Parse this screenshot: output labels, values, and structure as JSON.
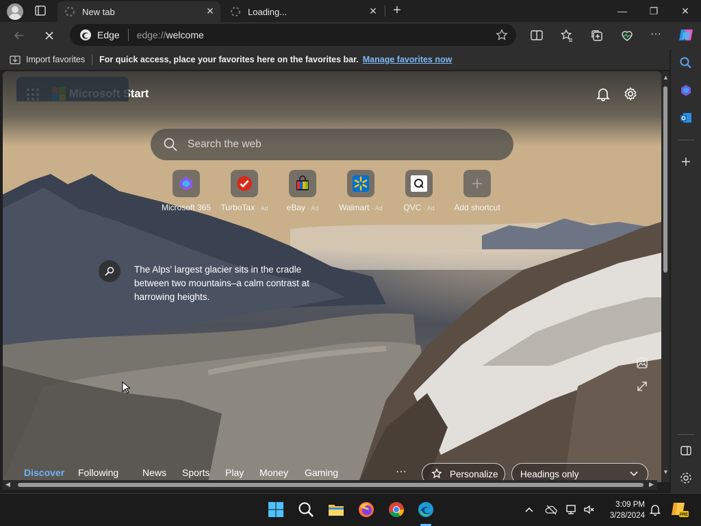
{
  "window": {
    "tabs": [
      {
        "title": "New tab",
        "active": true
      },
      {
        "title": "Loading...",
        "active": false
      }
    ],
    "controls": {
      "minimize": "—",
      "maximize": "❐",
      "close": "✕"
    }
  },
  "toolbar": {
    "site_label": "Edge",
    "url_scheme": "edge://",
    "url_host": "welcome"
  },
  "favorites_bar": {
    "import_label": "Import favorites",
    "message": "For quick access, place your favorites here on the favorites bar.",
    "manage_link": "Manage favorites now"
  },
  "page": {
    "brand": "Microsoft Start",
    "search_placeholder": "Search the web",
    "shortcuts": [
      {
        "label": "Microsoft 365",
        "ad": ""
      },
      {
        "label": "TurboTax",
        "ad": "· Ad"
      },
      {
        "label": "eBay",
        "ad": "· Ad"
      },
      {
        "label": "Walmart",
        "ad": "· Ad"
      },
      {
        "label": "QVC",
        "ad": "· Ad"
      },
      {
        "label": "Add shortcut",
        "ad": ""
      }
    ],
    "image_caption": "The Alps' largest glacier sits in the cradle between two mountains–a calm contrast at harrowing heights.",
    "feed_tabs": [
      "Discover",
      "Following",
      "News",
      "Sports",
      "Play",
      "Money",
      "Gaming"
    ],
    "more": "···",
    "personalize_label": "Personalize",
    "layout_select": "Headings only"
  },
  "taskbar": {
    "time": "3:09 PM",
    "date": "3/28/2024"
  },
  "colors": {
    "accent": "#6db4f7",
    "link": "#7fb8f5",
    "edge_blue": "#1e9bd7"
  }
}
